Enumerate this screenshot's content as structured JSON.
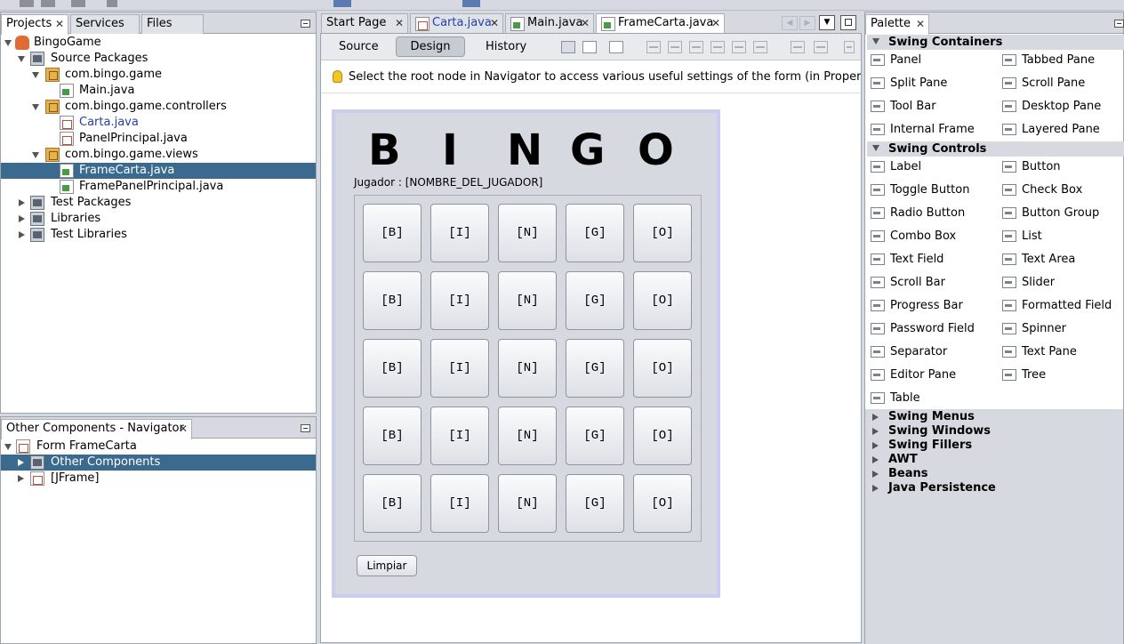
{
  "projects_panel": {
    "tabs": [
      "Projects",
      "Services",
      "Files"
    ],
    "tree": [
      {
        "label": "BingoGame",
        "level": 0,
        "expanded": true,
        "icon": "project-icon"
      },
      {
        "label": "Source Packages",
        "level": 1,
        "expanded": true,
        "icon": "source-folder-icon"
      },
      {
        "label": "com.bingo.game",
        "level": 2,
        "expanded": true,
        "icon": "package-icon"
      },
      {
        "label": "Main.java",
        "level": 3,
        "icon": "java-file-icon"
      },
      {
        "label": "com.bingo.game.controllers",
        "level": 2,
        "expanded": true,
        "icon": "package-icon"
      },
      {
        "label": "Carta.java",
        "level": 3,
        "icon": "java-class-icon"
      },
      {
        "label": "PanelPrincipal.java",
        "level": 3,
        "icon": "java-class-icon"
      },
      {
        "label": "com.bingo.game.views",
        "level": 2,
        "expanded": true,
        "icon": "package-icon"
      },
      {
        "label": "FrameCarta.java",
        "level": 3,
        "icon": "java-form-icon",
        "selected": true
      },
      {
        "label": "FramePanelPrincipal.java",
        "level": 3,
        "icon": "java-form-icon"
      },
      {
        "label": "Test Packages",
        "level": 1,
        "expanded": false,
        "icon": "folder-icon"
      },
      {
        "label": "Libraries",
        "level": 1,
        "expanded": false,
        "icon": "folder-icon"
      },
      {
        "label": "Test Libraries",
        "level": 1,
        "expanded": false,
        "icon": "folder-icon"
      }
    ]
  },
  "navigator_panel": {
    "title": "Other Components - Navigator",
    "tree": [
      {
        "label": "Form FrameCarta",
        "level": 0,
        "expanded": true,
        "icon": "form-icon"
      },
      {
        "label": "Other Components",
        "level": 1,
        "expanded": false,
        "icon": "components-icon",
        "selected": true
      },
      {
        "label": "[JFrame]",
        "level": 1,
        "expanded": false,
        "icon": "jframe-icon"
      }
    ]
  },
  "editor": {
    "tabs": [
      "Start Page",
      "Carta.java",
      "Main.java",
      "FrameCarta.java"
    ],
    "active_tab": "FrameCarta.java",
    "view_buttons": [
      "Source",
      "Design",
      "History"
    ],
    "active_view": "Design",
    "hint": "Select the root node in Navigator to access various useful settings of the form (in Properties"
  },
  "form": {
    "letters": [
      "B",
      "I",
      "N",
      "G",
      "O"
    ],
    "player_label": "Jugador : ",
    "player_name": "[NOMBRE_DEL_JUGADOR]",
    "cells": [
      [
        "[B]",
        "[I]",
        "[N]",
        "[G]",
        "[O]"
      ],
      [
        "[B]",
        "[I]",
        "[N]",
        "[G]",
        "[O]"
      ],
      [
        "[B]",
        "[I]",
        "[N]",
        "[G]",
        "[O]"
      ],
      [
        "[B]",
        "[I]",
        "[N]",
        "[G]",
        "[O]"
      ],
      [
        "[B]",
        "[I]",
        "[N]",
        "[G]",
        "[O]"
      ]
    ],
    "clear_button": "Limpiar"
  },
  "palette": {
    "title": "Palette",
    "swing_containers": {
      "label": "Swing Containers",
      "items": [
        "Panel",
        "Tabbed Pane",
        "Split Pane",
        "Scroll Pane",
        "Tool Bar",
        "Desktop Pane",
        "Internal Frame",
        "Layered Pane"
      ]
    },
    "swing_controls": {
      "label": "Swing Controls",
      "items": [
        "Label",
        "Button",
        "Toggle Button",
        "Check Box",
        "Radio Button",
        "Button Group",
        "Combo Box",
        "List",
        "Text Field",
        "Text Area",
        "Scroll Bar",
        "Slider",
        "Progress Bar",
        "Formatted Field",
        "Password Field",
        "Spinner",
        "Separator",
        "Text Pane",
        "Editor Pane",
        "Tree",
        "Table"
      ]
    },
    "collapsed_categories": [
      "Swing Menus",
      "Swing Windows",
      "Swing Fillers",
      "AWT",
      "Beans",
      "Java Persistence"
    ]
  }
}
